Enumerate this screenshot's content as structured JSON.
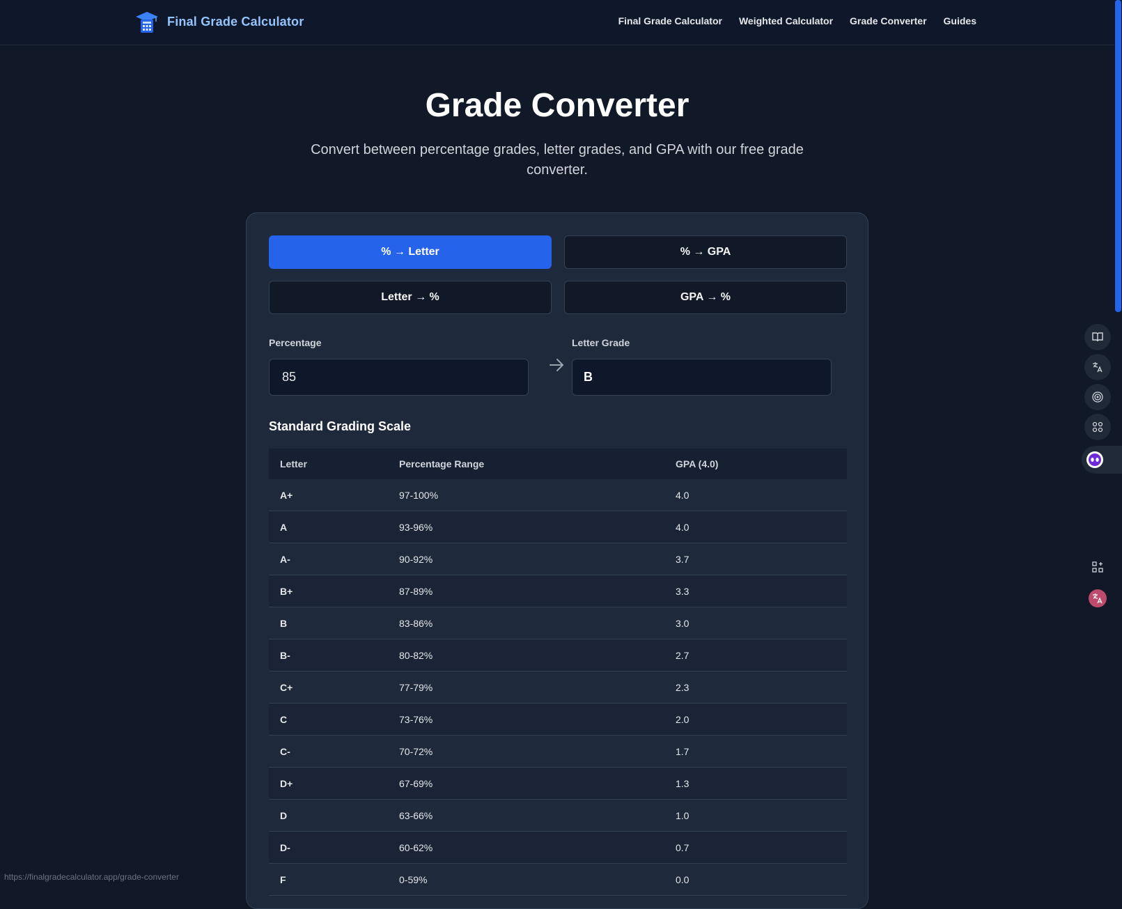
{
  "header": {
    "brand_title": "Final Grade Calculator",
    "nav": [
      "Final Grade Calculator",
      "Weighted Calculator",
      "Grade Converter",
      "Guides"
    ]
  },
  "hero": {
    "title": "Grade Converter",
    "subtitle": "Convert between percentage grades, letter grades, and GPA with our free grade converter."
  },
  "converter": {
    "tabs": [
      "% → Letter",
      "% → GPA",
      "Letter → %",
      "GPA → %"
    ],
    "active_tab": "% → Letter",
    "input_label": "Percentage",
    "input_value": "85",
    "output_label": "Letter Grade",
    "output_value": "B"
  },
  "scale": {
    "title": "Standard Grading Scale",
    "headers": [
      "Letter",
      "Percentage Range",
      "GPA (4.0)"
    ],
    "rows": [
      [
        "A+",
        "97-100%",
        "4.0"
      ],
      [
        "A",
        "93-96%",
        "4.0"
      ],
      [
        "A-",
        "90-92%",
        "3.7"
      ],
      [
        "B+",
        "87-89%",
        "3.3"
      ],
      [
        "B",
        "83-86%",
        "3.0"
      ],
      [
        "B-",
        "80-82%",
        "2.7"
      ],
      [
        "C+",
        "77-79%",
        "2.3"
      ],
      [
        "C",
        "73-76%",
        "2.0"
      ],
      [
        "C-",
        "70-72%",
        "1.7"
      ],
      [
        "D+",
        "67-69%",
        "1.3"
      ],
      [
        "D",
        "63-66%",
        "1.0"
      ],
      [
        "D-",
        "60-62%",
        "0.7"
      ],
      [
        "F",
        "0-59%",
        "0.0"
      ]
    ]
  },
  "side_toolbar": [
    "book-icon",
    "translate-icon",
    "broadcast-icon",
    "command-icon",
    "assistant-icon",
    "add-widget-icon",
    "translate-badge-icon"
  ],
  "status_url": "https://finalgradecalculator.app/grade-converter",
  "colors": {
    "background": "#111827",
    "card": "#1e293b",
    "accent": "#2563eb",
    "brand": "#93c5fd"
  }
}
